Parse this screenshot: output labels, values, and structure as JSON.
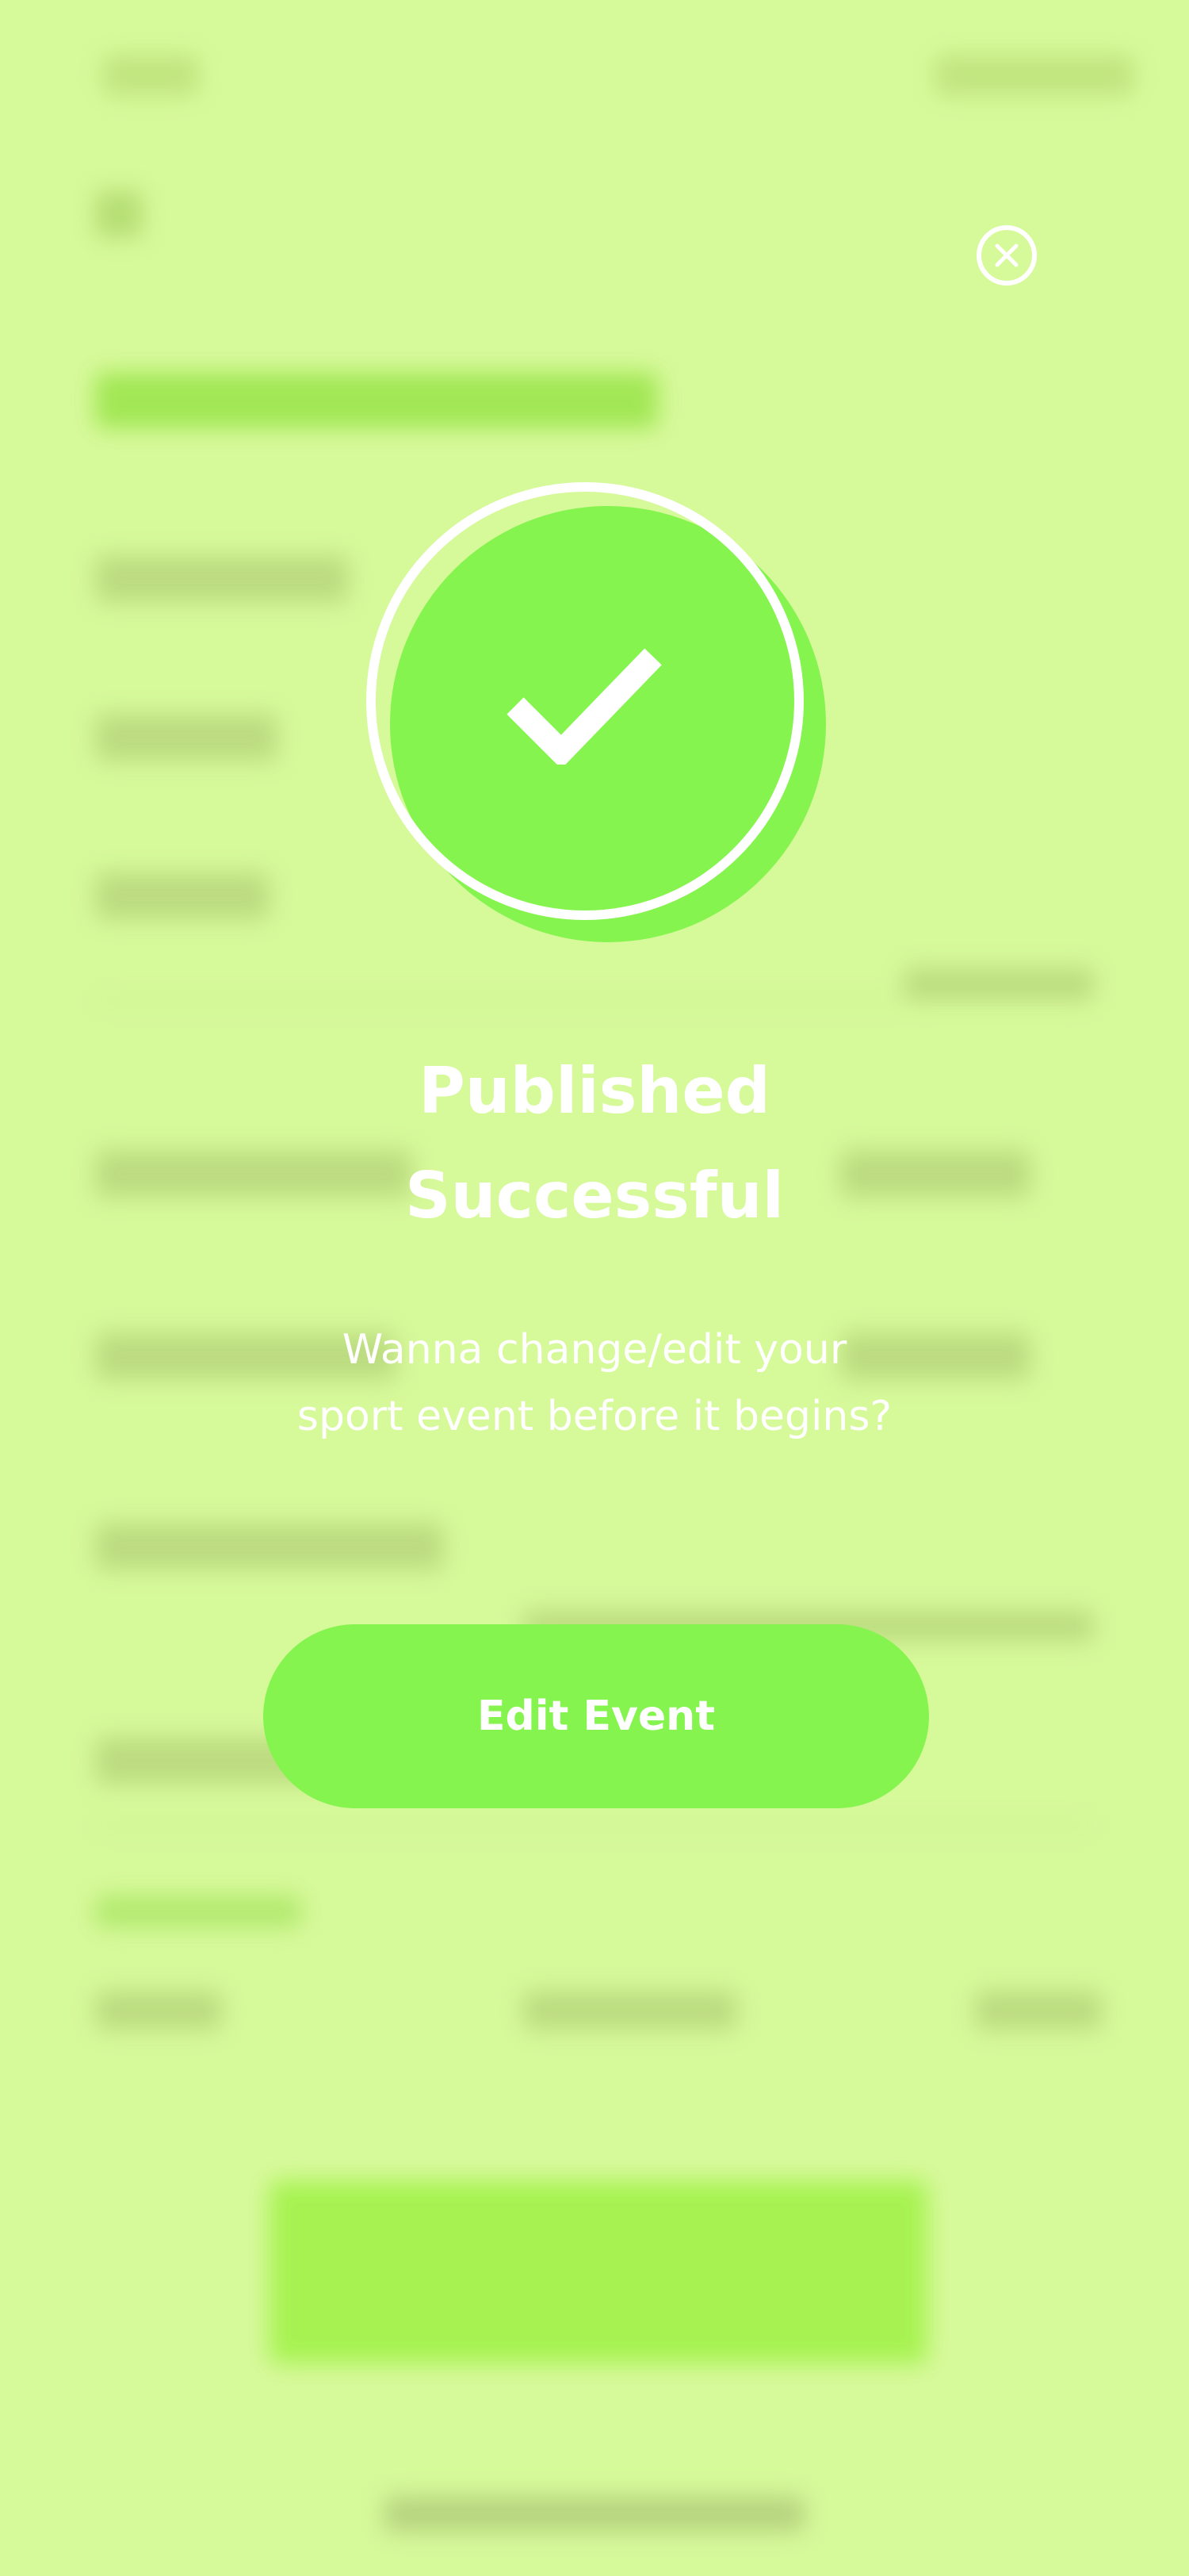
{
  "modal": {
    "title_line1": "Published",
    "title_line2": "Successful",
    "subtitle_line1": "Wanna change/edit your",
    "subtitle_line2": "sport event before it begins?",
    "edit_button_label": "Edit Event",
    "close_icon": "close-circle-icon",
    "status_icon": "check-icon"
  },
  "colors": {
    "background": "#d6f99a",
    "accent_green": "#86f44f",
    "text": "#ffffff"
  }
}
